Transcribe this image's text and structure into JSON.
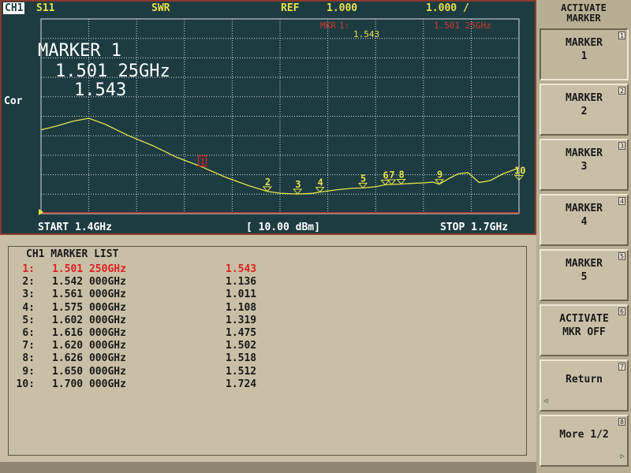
{
  "header": {
    "channel": "CH1",
    "param": "S11",
    "format": "SWR",
    "ref_label": "REF",
    "ref_value": "1.000",
    "scale": "1.000 /",
    "mkr_label": "MKR",
    "mkr_num": "1:",
    "mkr_value": "1.543",
    "mkr_freq": "1.501 25GHz"
  },
  "side_label": "Cor",
  "marker_readout": {
    "title": "MARKER 1",
    "freq": "1.501 25GHz",
    "value": "1.543"
  },
  "footer": {
    "start": "START 1.4GHz",
    "power": "[ 10.00 dBm]",
    "stop": "STOP 1.7GHz"
  },
  "marker_list": {
    "title": "CH1 MARKER LIST",
    "rows": [
      {
        "idx": "1:",
        "freq": "1.501 250GHz",
        "value": "1.543",
        "active": true
      },
      {
        "idx": "2:",
        "freq": "1.542 000GHz",
        "value": "1.136",
        "active": false
      },
      {
        "idx": "3:",
        "freq": "1.561 000GHz",
        "value": "1.011",
        "active": false
      },
      {
        "idx": "4:",
        "freq": "1.575 000GHz",
        "value": "1.108",
        "active": false
      },
      {
        "idx": "5:",
        "freq": "1.602 000GHz",
        "value": "1.319",
        "active": false
      },
      {
        "idx": "6:",
        "freq": "1.616 000GHz",
        "value": "1.475",
        "active": false
      },
      {
        "idx": "7:",
        "freq": "1.620 000GHz",
        "value": "1.502",
        "active": false
      },
      {
        "idx": "8:",
        "freq": "1.626 000GHz",
        "value": "1.518",
        "active": false
      },
      {
        "idx": "9:",
        "freq": "1.650 000GHz",
        "value": "1.512",
        "active": false
      },
      {
        "idx": "10:",
        "freq": "1.700 000GHz",
        "value": "1.724",
        "active": false
      }
    ]
  },
  "trace": {
    "x_start_ghz": 1.4,
    "x_stop_ghz": 1.7,
    "points": [
      [
        1.4,
        4.3
      ],
      [
        1.41,
        4.5
      ],
      [
        1.42,
        4.75
      ],
      [
        1.43,
        4.9
      ],
      [
        1.44,
        4.6
      ],
      [
        1.455,
        4.0
      ],
      [
        1.47,
        3.5
      ],
      [
        1.485,
        2.9
      ],
      [
        1.501,
        2.4
      ],
      [
        1.515,
        1.9
      ],
      [
        1.53,
        1.45
      ],
      [
        1.542,
        1.14
      ],
      [
        1.55,
        1.05
      ],
      [
        1.561,
        1.01
      ],
      [
        1.57,
        1.04
      ],
      [
        1.575,
        1.11
      ],
      [
        1.585,
        1.22
      ],
      [
        1.595,
        1.3
      ],
      [
        1.602,
        1.32
      ],
      [
        1.61,
        1.38
      ],
      [
        1.616,
        1.48
      ],
      [
        1.62,
        1.5
      ],
      [
        1.626,
        1.52
      ],
      [
        1.632,
        1.55
      ],
      [
        1.64,
        1.58
      ],
      [
        1.646,
        1.62
      ],
      [
        1.65,
        1.51
      ],
      [
        1.656,
        1.8
      ],
      [
        1.662,
        2.05
      ],
      [
        1.668,
        2.1
      ],
      [
        1.675,
        1.6
      ],
      [
        1.682,
        1.7
      ],
      [
        1.69,
        2.05
      ],
      [
        1.7,
        2.35
      ]
    ],
    "markers": [
      {
        "label": "1",
        "x": 1.50125,
        "y": 2.4,
        "active": true
      },
      {
        "label": "2",
        "x": 1.542,
        "y": 1.14,
        "active": false
      },
      {
        "label": "3",
        "x": 1.561,
        "y": 1.01,
        "active": false
      },
      {
        "label": "4",
        "x": 1.575,
        "y": 1.11,
        "active": false
      },
      {
        "label": "5",
        "x": 1.602,
        "y": 1.32,
        "active": false
      },
      {
        "label": "6",
        "x": 1.616,
        "y": 1.48,
        "active": false
      },
      {
        "label": "7",
        "x": 1.62,
        "y": 1.5,
        "active": false
      },
      {
        "label": "8",
        "x": 1.626,
        "y": 1.52,
        "active": false
      },
      {
        "label": "9",
        "x": 1.65,
        "y": 1.51,
        "active": false
      },
      {
        "label": "10",
        "x": 1.7,
        "y": 1.72,
        "active": false
      }
    ]
  },
  "softkeys": {
    "menu_title": "ACTIVATE\nMARKER",
    "keys": [
      {
        "label": "MARKER\n1",
        "num": "1",
        "selected": true
      },
      {
        "label": "MARKER\n2",
        "num": "2",
        "selected": false
      },
      {
        "label": "MARKER\n3",
        "num": "3",
        "selected": false
      },
      {
        "label": "MARKER\n4",
        "num": "4",
        "selected": false
      },
      {
        "label": "MARKER\n5",
        "num": "5",
        "selected": false
      },
      {
        "label": "ACTIVATE\nMKR OFF",
        "num": "6",
        "selected": false
      },
      {
        "label": "Return",
        "num": "7",
        "selected": false
      },
      {
        "label": "More 1/2",
        "num": "8",
        "selected": false
      }
    ]
  },
  "colors": {
    "screen_bg": "#1d3c42",
    "grid": "#dddddd",
    "trace": "#e8e04a",
    "active_marker": "#e02020",
    "header_text": "#e8e04a",
    "active_mkr_header": "#d03a2a"
  }
}
